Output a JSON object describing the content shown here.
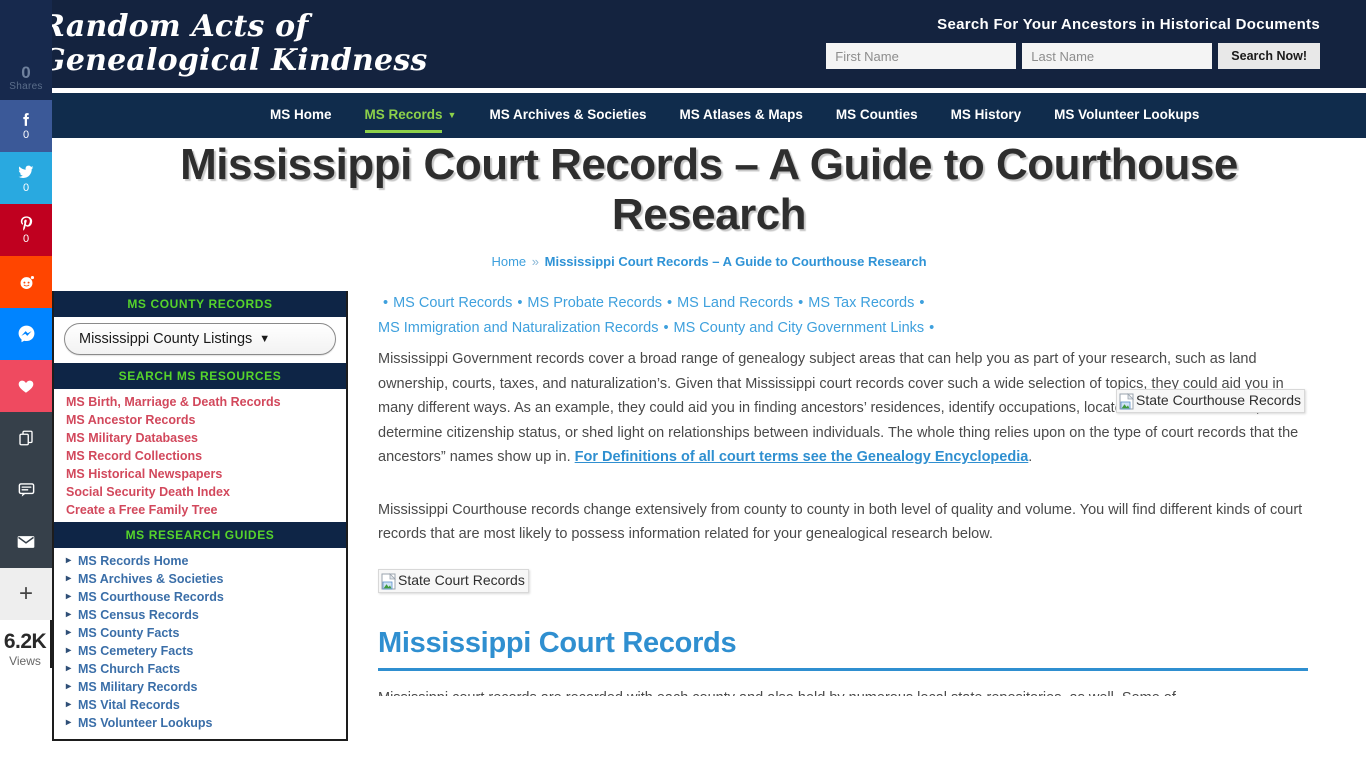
{
  "header": {
    "logo_line1": "Random Acts of",
    "logo_line2": "Genealogical Kindness",
    "search_title": "Search For Your Ancestors in Historical Documents",
    "first_name_placeholder": "First Name",
    "first_name_value": "",
    "last_name_placeholder": "Last Name",
    "last_name_value": "",
    "search_button": "Search Now!"
  },
  "nav": {
    "items": [
      {
        "label": "MS Home",
        "active": false,
        "has_caret": false
      },
      {
        "label": "MS Records",
        "active": true,
        "has_caret": true
      },
      {
        "label": "MS Archives & Societies",
        "active": false,
        "has_caret": false
      },
      {
        "label": "MS Atlases & Maps",
        "active": false,
        "has_caret": false
      },
      {
        "label": "MS Counties",
        "active": false,
        "has_caret": false
      },
      {
        "label": "MS History",
        "active": false,
        "has_caret": false
      },
      {
        "label": "MS Volunteer Lookups",
        "active": false,
        "has_caret": false
      }
    ]
  },
  "title": {
    "page_title": "Mississippi Court Records – A Guide to Courthouse Research",
    "breadcrumb_home": "Home",
    "breadcrumb_separator": "»",
    "breadcrumb_current": "Mississippi Court Records – A Guide to Courthouse Research"
  },
  "share_rail": {
    "total_count": "0",
    "total_label": "Shares",
    "buttons": [
      {
        "icon": "facebook-icon",
        "count": "0"
      },
      {
        "icon": "twitter-icon",
        "count": "0"
      },
      {
        "icon": "pinterest-icon",
        "count": "0"
      },
      {
        "icon": "reddit-icon",
        "count": ""
      },
      {
        "icon": "messenger-icon",
        "count": ""
      },
      {
        "icon": "heart-icon",
        "count": ""
      },
      {
        "icon": "copy-icon",
        "count": ""
      },
      {
        "icon": "comment-icon",
        "count": ""
      },
      {
        "icon": "email-icon",
        "count": ""
      }
    ],
    "more_label": "+",
    "views_count": "6.2K",
    "views_label": "Views"
  },
  "sidebar": {
    "widgets": [
      {
        "title": "MS COUNTY RECORDS",
        "type": "select",
        "select_value": "Mississippi County Listings",
        "select_caret": "▼"
      },
      {
        "title": "SEARCH MS RESOURCES",
        "type": "links",
        "items": [
          "MS Birth, Marriage & Death Records",
          "MS Ancestor Records",
          "MS Military Databases",
          "MS Record Collections",
          "MS Historical Newspapers",
          "Social Security Death Index",
          "Create a Free Family Tree"
        ]
      },
      {
        "title": "MS RESEARCH GUIDES",
        "type": "guides",
        "items": [
          "MS Records Home",
          "MS Archives & Societies",
          "MS Courthouse Records",
          "MS Census Records",
          "MS County Facts",
          "MS Cemetery Facts",
          "MS Church Facts",
          "MS Military Records",
          "MS Vital Records",
          "MS Volunteer Lookups"
        ]
      }
    ]
  },
  "content": {
    "toc": {
      "lead_dot": "•",
      "links": [
        "MS Court Records",
        "MS Probate Records",
        "MS Land Records",
        "MS Tax Records",
        "MS Immigration and Naturalization Records",
        "MS County and City Government Links"
      ]
    },
    "paragraph1_before_link": "Mississippi Government records cover a broad range of genealogy subject areas that can help you as part of your research, such as land ownership, courts, taxes, and naturalization’s. Given that Mississippi court records cover such a wide selection of topics, they could aid you in many different ways. As an example, they could aid you in finding ancestors’ residences, identify occupations, locate financial information, determine citizenship status, or shed light on relationships between individuals. The whole thing relies upon on the type of court records that the ancestors” names show up in. ",
    "paragraph1_link": "For Definitions of all court terms see the Genealogy Encyclopedia",
    "paragraph1_after_link": ".",
    "paragraph2": "Mississippi Courthouse records change extensively from county to county in both level of quality and volume. You will find different kinds of court records that are most likely to possess information related for your genealogical research below.",
    "image_courthouse_alt": "State Courthouse Records",
    "image_courtrecords_alt": "State Court Records",
    "section_heading": "Mississippi Court Records",
    "tail_text": "Mississippi court records are recorded with each county and also held by numerous local state repositories, as well. Some of"
  },
  "colors": {
    "header_bg": "#14233f",
    "nav_bg": "#102c4c",
    "nav_active": "#8dd14a",
    "widget_head_bg": "#0e2546",
    "widget_head_text": "#56d42b",
    "link_blue": "#3ea0dd",
    "heading_blue": "#2f8fd0",
    "sidebar_link_red": "#d2485c",
    "sidebar_guide_blue": "#3a6ea8"
  }
}
